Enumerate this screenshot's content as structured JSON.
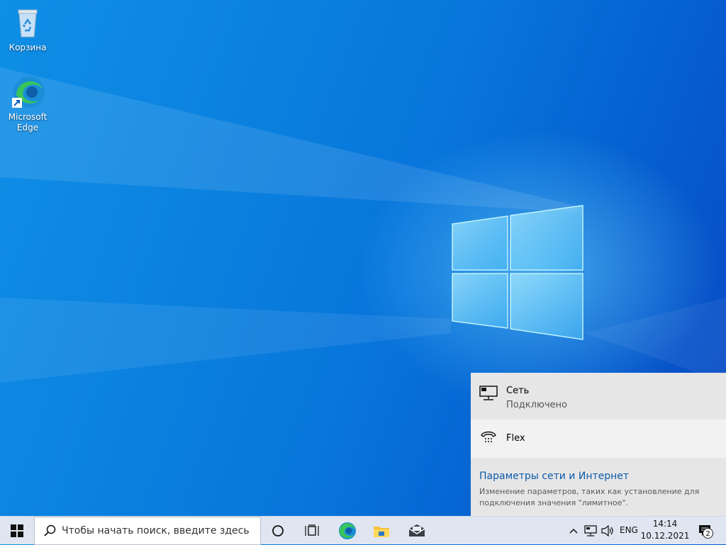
{
  "desktop": {
    "icons": [
      {
        "label": "Корзина",
        "icon": "recycle-bin-icon"
      },
      {
        "label": "Microsoft Edge",
        "icon": "edge-icon"
      }
    ]
  },
  "network_flyout": {
    "connected": {
      "title": "Сеть",
      "status": "Подключено",
      "icon": "ethernet-icon"
    },
    "other": {
      "title": "Flex",
      "icon": "dialup-icon"
    },
    "settings_link": "Параметры сети и Интернет",
    "settings_desc": "Изменение параметров, таких как установление для подключения значения \"лимитное\"."
  },
  "taskbar": {
    "search_placeholder": "Чтобы начать поиск, введите здесь",
    "pinned": [
      "edge-icon",
      "file-explorer-icon",
      "mail-icon"
    ],
    "tray": {
      "language": "ENG",
      "time": "14:14",
      "date": "10.12.2021",
      "notifications": "2"
    }
  },
  "colors": {
    "wallpaper_primary": "#0a7fde",
    "taskbar": "#dfe6f1",
    "flyout": "#e6e6e6",
    "link": "#0b5aa8"
  }
}
